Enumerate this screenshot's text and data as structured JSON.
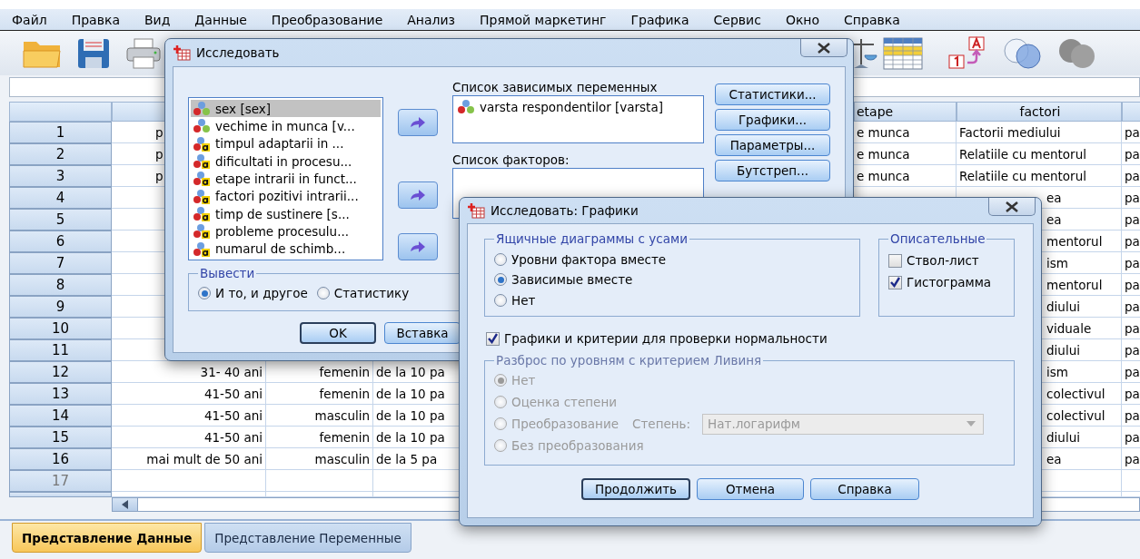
{
  "menu": [
    "Файл",
    "Правка",
    "Вид",
    "Данные",
    "Преобразование",
    "Анализ",
    "Прямой маркетинг",
    "Графика",
    "Сервис",
    "Окно",
    "Справка"
  ],
  "grid": {
    "headers": {
      "column_4": "etape",
      "column_5": "factori"
    },
    "rows": [
      {
        "number": "1",
        "cells": {
          "column_1": {
            "text": "p",
            "cut_right": true
          },
          "column_4": {
            "text": "e munca"
          },
          "column_5": {
            "text": "Factorii mediului"
          },
          "column_6": {
            "text": "pa"
          }
        }
      },
      {
        "number": "2",
        "cells": {
          "column_1": {
            "text": "p",
            "cut_right": true
          },
          "column_4": {
            "text": "e munca"
          },
          "column_5": {
            "text": "Relatiile cu mentorul"
          },
          "column_6": {
            "text": "pa"
          }
        }
      },
      {
        "number": "3",
        "cells": {
          "column_1": {
            "text": "p",
            "cut_right": true
          },
          "column_4": {
            "text": "e munca"
          },
          "column_5": {
            "text": "Relatiile cu mentorul"
          },
          "column_6": {
            "text": "pa"
          }
        }
      },
      {
        "number": "4",
        "cells": {
          "column_5": {
            "text": "ea",
            "cut_left": true
          },
          "column_6": {
            "text": "pa"
          }
        }
      },
      {
        "number": "5",
        "cells": {
          "column_5": {
            "text": "ea",
            "cut_left": true
          },
          "column_6": {
            "text": "pa"
          }
        }
      },
      {
        "number": "6",
        "cells": {
          "column_5": {
            "text": "mentorul",
            "cut_left": true
          },
          "column_6": {
            "text": "pa"
          }
        }
      },
      {
        "number": "7",
        "cells": {
          "column_5": {
            "text": "ism",
            "cut_left": true
          },
          "column_6": {
            "text": "pa"
          }
        }
      },
      {
        "number": "8",
        "cells": {
          "column_5": {
            "text": "mentorul",
            "cut_left": true
          },
          "column_6": {
            "text": "pa"
          }
        }
      },
      {
        "number": "9",
        "cells": {
          "column_5": {
            "text": "diului",
            "cut_left": true
          },
          "column_6": {
            "text": "pa"
          }
        }
      },
      {
        "number": "10",
        "cells": {
          "column_5": {
            "text": "viduale",
            "cut_left": true
          },
          "column_6": {
            "text": "pa"
          }
        }
      },
      {
        "number": "11",
        "cells": {
          "column_5": {
            "text": "diului",
            "cut_left": true
          },
          "column_6": {
            "text": "pa"
          }
        }
      },
      {
        "number": "12",
        "cells": {
          "column_1": {
            "text": "31- 40 ani"
          },
          "column_2": {
            "text": "femenin"
          },
          "column_3": {
            "text": "de la 10 pa"
          },
          "column_5": {
            "text": "ism",
            "cut_left": true
          },
          "column_6": {
            "text": "pa"
          }
        }
      },
      {
        "number": "13",
        "cells": {
          "column_1": {
            "text": "41-50 ani"
          },
          "column_2": {
            "text": "femenin"
          },
          "column_3": {
            "text": "de la 10 pa"
          },
          "column_5": {
            "text": "colectivul",
            "cut_left": true
          },
          "column_6": {
            "text": "pa"
          }
        }
      },
      {
        "number": "14",
        "cells": {
          "column_1": {
            "text": "41-50 ani"
          },
          "column_2": {
            "text": "masculin"
          },
          "column_3": {
            "text": "de la 10 pa"
          },
          "column_5": {
            "text": "colectivul",
            "cut_left": true
          },
          "column_6": {
            "text": "pa"
          }
        }
      },
      {
        "number": "15",
        "cells": {
          "column_1": {
            "text": "41-50 ani"
          },
          "column_2": {
            "text": "femenin"
          },
          "column_3": {
            "text": "de la 10 pa"
          },
          "column_5": {
            "text": "diului",
            "cut_left": true
          },
          "column_6": {
            "text": "pa"
          }
        }
      },
      {
        "number": "16",
        "cells": {
          "column_1": {
            "text": "mai mult de 50 ani"
          },
          "column_2": {
            "text": "masculin"
          },
          "column_3": {
            "text": "de la 5 pa"
          },
          "column_5": {
            "text": "ea",
            "cut_left": true
          },
          "column_6": {
            "text": "pa"
          }
        }
      },
      {
        "number": "17",
        "cells": {}
      }
    ]
  },
  "explore_dialog": {
    "title": "Исследовать",
    "variables": [
      {
        "name": "sex  [sex]",
        "kind": "nominal",
        "selected": true
      },
      {
        "name": "vechime in munca [v...",
        "kind": "nominal",
        "selected": false
      },
      {
        "name": "timpul adaptarii in ...",
        "kind": "string",
        "selected": false
      },
      {
        "name": "dificultati in procesu...",
        "kind": "string",
        "selected": false
      },
      {
        "name": "etape intrarii in funct...",
        "kind": "string",
        "selected": false
      },
      {
        "name": "factori pozitivi intrarii...",
        "kind": "string",
        "selected": false
      },
      {
        "name": "timp de sustinere [s...",
        "kind": "string",
        "selected": false
      },
      {
        "name": "probleme procesulu...",
        "kind": "string",
        "selected": false
      },
      {
        "name": "numarul de schimb...",
        "kind": "string",
        "selected": false
      }
    ],
    "dependent_label": "Список зависимых переменных",
    "dependents": [
      {
        "name": "varsta respondentilor [varsta]",
        "kind": "nominal"
      }
    ],
    "factor_label": "Список факторов:",
    "side_buttons": [
      "Статистики...",
      "Графики...",
      "Параметры...",
      "Бутстреп..."
    ],
    "display": {
      "title": "Вывести",
      "options": [
        {
          "label": "И то, и другое",
          "selected": true
        },
        {
          "label": "Статистику",
          "selected": false
        }
      ]
    },
    "buttons": [
      {
        "label": "OK",
        "default": true
      },
      {
        "label": "Вставка",
        "default": false
      }
    ]
  },
  "plots_dialog": {
    "title": "Исследовать: Графики",
    "boxplots": {
      "title": "Ящичные диаграммы с усами",
      "options": [
        {
          "label": "Уровни фактора вместе",
          "selected": false
        },
        {
          "label": "Зависимые вместе",
          "selected": true
        },
        {
          "label": "Нет",
          "selected": false
        }
      ]
    },
    "descriptive": {
      "title": "Описательные",
      "options": [
        {
          "label": "Ствол-лист",
          "checked": false
        },
        {
          "label": "Гистограмма",
          "checked": true
        }
      ]
    },
    "normality": {
      "label": "Графики и критерии для проверки нормальности",
      "checked": true
    },
    "spread": {
      "title": "Разброс по уровням с критерием Ливиня",
      "disabled": true,
      "options": [
        {
          "label": "Нет",
          "selected": true,
          "kind": "plain"
        },
        {
          "label": "Оценка степени",
          "selected": false,
          "kind": "plain"
        },
        {
          "label": "Преобразование",
          "selected": false,
          "kind": "power"
        },
        {
          "label": "Без преобразования",
          "selected": false,
          "kind": "plain"
        }
      ],
      "power_label": "Степень:",
      "power_value": "Нат.логарифм"
    },
    "buttons": [
      {
        "label": "Продолжить",
        "default": true
      },
      {
        "label": "Отмена",
        "default": false
      },
      {
        "label": "Справка",
        "default": false
      }
    ]
  },
  "tabs": [
    {
      "label": "Представление Данные",
      "selected": true
    },
    {
      "label": "Представление Переменные",
      "selected": false
    }
  ]
}
